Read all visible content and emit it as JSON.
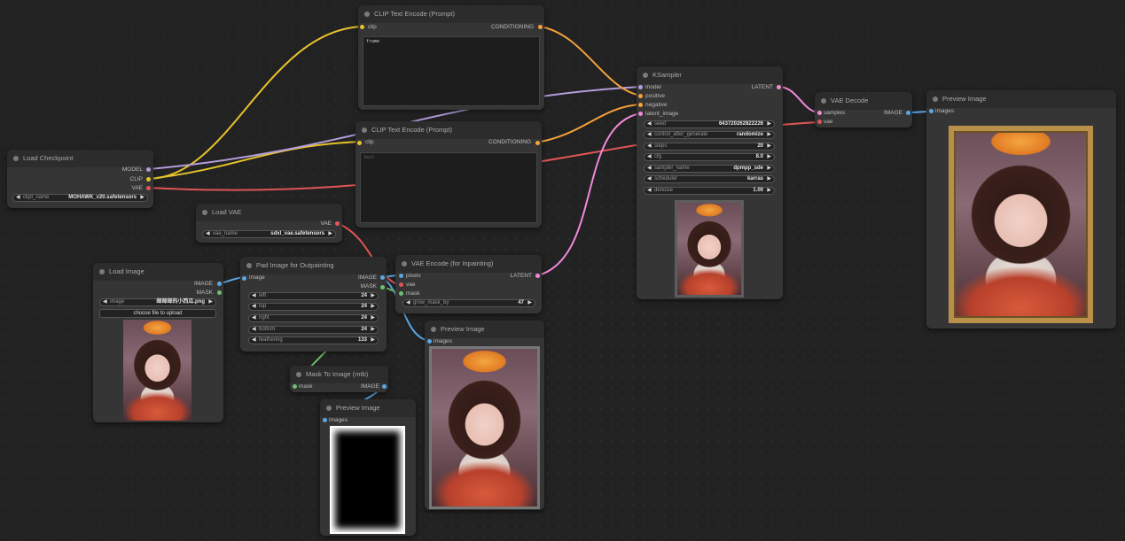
{
  "colors": {
    "clip": "#e6c32c",
    "model": "#b39ddb",
    "conditioning": "#f4a23a",
    "vae": "#e05555",
    "latent": "#f08ad8",
    "image": "#5aa7e6",
    "mask": "#6fc06f"
  },
  "clip_text_encode_1": {
    "title": "CLIP Text Encode (Prompt)",
    "input_clip": "clip",
    "output": "CONDITIONING",
    "text": "frame"
  },
  "clip_text_encode_2": {
    "title": "CLIP Text Encode (Prompt)",
    "input_clip": "clip",
    "output": "CONDITIONING",
    "text": "text"
  },
  "load_checkpoint": {
    "title": "Load Checkpoint",
    "out_model": "MODEL",
    "out_clip": "CLIP",
    "out_vae": "VAE",
    "ckpt_label": "ckpt_name",
    "ckpt_value": "MOHAWK_v20.safetensors"
  },
  "load_vae": {
    "title": "Load VAE",
    "out_vae": "VAE",
    "vae_label": "vae_name",
    "vae_value": "sdxl_vae.safetensors"
  },
  "load_image": {
    "title": "Load Image",
    "out_image": "IMAGE",
    "out_mask": "MASK",
    "image_label": "image",
    "image_value": "邮邮邮的小西瓜.png",
    "upload_label": "choose file to upload"
  },
  "pad_image": {
    "title": "Pad Image for Outpainting",
    "in_image": "image",
    "out_image": "IMAGE",
    "out_mask": "MASK",
    "widgets": [
      {
        "label": "left",
        "value": "24"
      },
      {
        "label": "top",
        "value": "24"
      },
      {
        "label": "right",
        "value": "24"
      },
      {
        "label": "bottom",
        "value": "24"
      },
      {
        "label": "feathering",
        "value": "133"
      }
    ]
  },
  "vae_encode": {
    "title": "VAE Encode (for Inpainting)",
    "in_pixels": "pixels",
    "in_vae": "vae",
    "in_mask": "mask",
    "out_latent": "LATENT",
    "grow_label": "grow_mask_by",
    "grow_value": "47"
  },
  "mask_to_image": {
    "title": "Mask To Image (mtb)",
    "in_mask": "mask",
    "out_image": "IMAGE"
  },
  "preview_mask": {
    "title": "Preview Image",
    "in_images": "images"
  },
  "preview_mid": {
    "title": "Preview Image",
    "in_images": "images"
  },
  "ksampler": {
    "title": "KSampler",
    "in_model": "model",
    "in_positive": "positive",
    "in_negative": "negative",
    "in_latent": "latent_image",
    "out_latent": "LATENT",
    "widgets": [
      {
        "label": "seed",
        "value": "643720262822226"
      },
      {
        "label": "control_after_generate",
        "value": "randomize"
      },
      {
        "label": "steps",
        "value": "20"
      },
      {
        "label": "cfg",
        "value": "8.0"
      },
      {
        "label": "sampler_name",
        "value": "dpmpp_sde"
      },
      {
        "label": "scheduler",
        "value": "karras"
      },
      {
        "label": "denoise",
        "value": "1.00"
      }
    ]
  },
  "vae_decode": {
    "title": "VAE Decode",
    "in_samples": "samples",
    "in_vae": "vae",
    "out_image": "IMAGE"
  },
  "preview_final": {
    "title": "Preview Image",
    "in_images": "images"
  }
}
